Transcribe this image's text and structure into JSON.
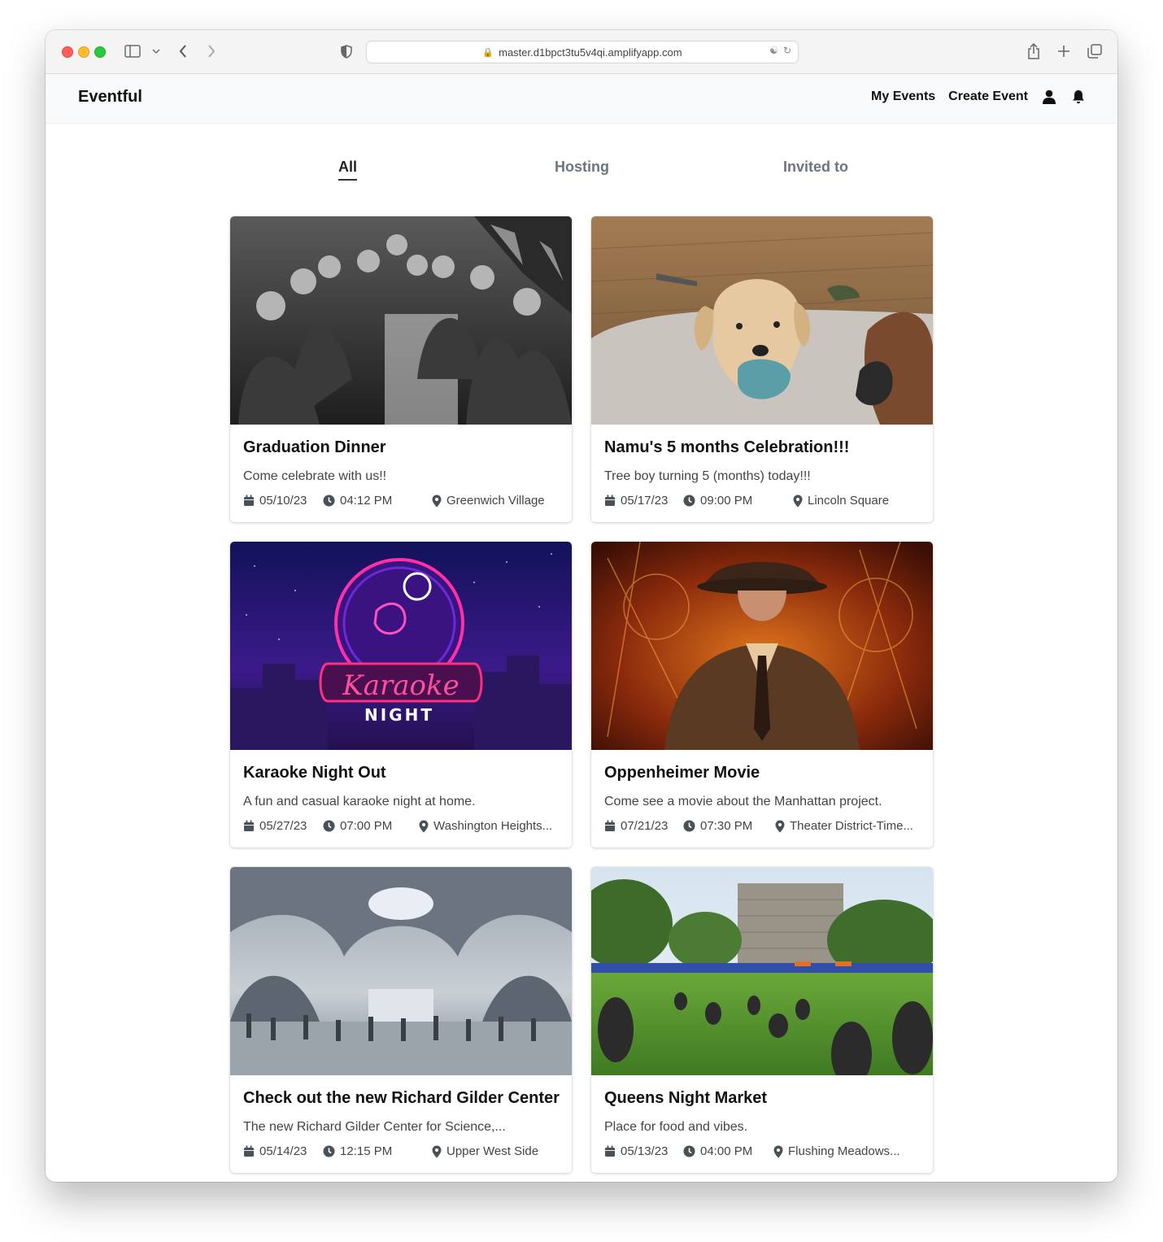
{
  "browser": {
    "url": "master.d1bpct3tu5v4qi.amplifyapp.com"
  },
  "navbar": {
    "brand": "Eventful",
    "links": [
      "My Events",
      "Create Event"
    ],
    "icons": [
      "user-icon",
      "bell-icon"
    ]
  },
  "tabs": [
    {
      "label": "All",
      "active": true
    },
    {
      "label": "Hosting",
      "active": false
    },
    {
      "label": "Invited to",
      "active": false
    }
  ],
  "events": [
    {
      "title": "Graduation Dinner",
      "description": "Come celebrate with us!!",
      "date": "05/10/23",
      "time": "04:12 PM",
      "location": "Greenwich Village",
      "image": "group-photo-bw"
    },
    {
      "title": "Namu's 5 months Celebration!!!",
      "description": "Tree boy turning 5 (months) today!!!",
      "date": "05/17/23",
      "time": "09:00 PM",
      "location": "Lincoln Square",
      "image": "puppy-photo"
    },
    {
      "title": "Karaoke Night Out",
      "description": "A fun and casual karaoke night at home.",
      "date": "05/27/23",
      "time": "07:00 PM",
      "location": "Washington Heights...",
      "image": "karaoke-neon-sign",
      "image_text": [
        "Karaoke",
        "NIGHT"
      ]
    },
    {
      "title": "Oppenheimer Movie",
      "description": "Come see a movie about the Manhattan project.",
      "date": "07/21/23",
      "time": "07:30 PM",
      "location": "Theater District-Time...",
      "image": "movie-poster"
    },
    {
      "title": "Check out the new Richard Gilder Center",
      "description": "The new Richard Gilder Center for Science,...",
      "date": "05/14/23",
      "time": "12:15 PM",
      "location": "Upper West Side",
      "image": "museum-atrium"
    },
    {
      "title": "Queens Night Market",
      "description": "Place for food and vibes.",
      "date": "05/13/23",
      "time": "04:00 PM",
      "location": "Flushing Meadows...",
      "image": "park-market"
    }
  ]
}
